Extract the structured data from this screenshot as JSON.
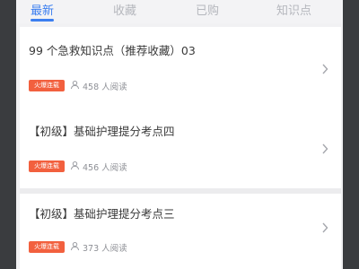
{
  "tabs": [
    {
      "label": "最新",
      "active": true
    },
    {
      "label": "收藏",
      "active": false
    },
    {
      "label": "已购",
      "active": false
    },
    {
      "label": "知识点",
      "active": false
    }
  ],
  "items": [
    {
      "title": "99 个急救知识点（推荐收藏）03",
      "tag": "火爆连载",
      "read_count": "458",
      "read_suffix": "人阅读"
    },
    {
      "title": "【初级】基础护理提分考点四",
      "tag": "火爆连载",
      "read_count": "456",
      "read_suffix": "人阅读"
    },
    {
      "title": "【初级】基础护理提分考点三",
      "tag": "火爆连载",
      "read_count": "373",
      "read_suffix": "人阅读"
    }
  ],
  "colors": {
    "accent": "#3c7ff0",
    "tag": "#f2603e"
  },
  "icons": {
    "reader": "person-icon",
    "chevron": "chevron-right-icon"
  }
}
